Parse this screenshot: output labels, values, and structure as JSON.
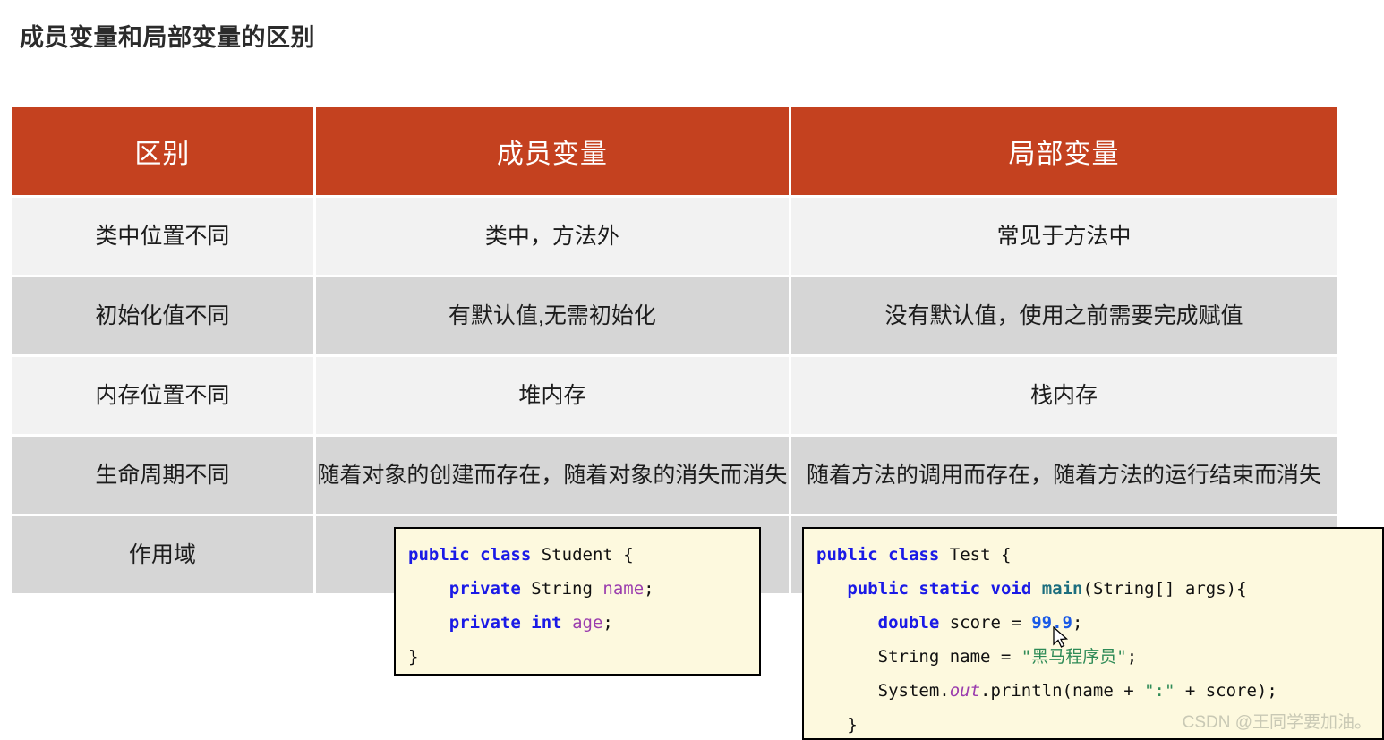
{
  "page": {
    "title": "成员变量和局部变量的区别",
    "watermark": "CSDN @王同学要加油。"
  },
  "table": {
    "headers": {
      "col1": "区别",
      "col2": "成员变量",
      "col3": "局部变量"
    },
    "rows": [
      {
        "diff": "类中位置不同",
        "member": "类中，方法外",
        "local": "常见于方法中"
      },
      {
        "diff": "初始化值不同",
        "member": "有默认值,无需初始化",
        "local": "没有默认值，使用之前需要完成赋值"
      },
      {
        "diff": "内存位置不同",
        "member": "堆内存",
        "local": "栈内存"
      },
      {
        "diff": "生命周期不同",
        "member": "随着对象的创建而存在，随着对象的消失而消失",
        "local": "随着方法的调用而存在，随着方法的运行结束而消失"
      },
      {
        "diff": "作用域",
        "member": "",
        "local": ""
      }
    ]
  },
  "code_student": {
    "line1_kw_public": "public",
    "line1_kw_class": "class",
    "line1_name": "Student",
    "line1_brace": "{",
    "line2_kw": "private",
    "line2_type": "String",
    "line2_field": "name",
    "line2_semi": ";",
    "line3_kw": "private",
    "line3_type": "int",
    "line3_field": "age",
    "line3_semi": ";",
    "line4_brace": "}"
  },
  "code_test": {
    "l1_public": "public",
    "l1_class": "class",
    "l1_name": "Test",
    "l1_brace": "{",
    "l2_public": "public",
    "l2_static": "static",
    "l2_void": "void",
    "l2_main": "main",
    "l2_args": "(String[] args){",
    "l3_double": "double",
    "l3_var": " score = ",
    "l3_num": "99.9",
    "l3_semi": ";",
    "l4_text": "String name = ",
    "l4_str": "\"黑马程序员\"",
    "l4_semi": ";",
    "l5_sys": "System.",
    "l5_out": "out",
    "l5_rest": ".println(name + ",
    "l5_str": "\":\"",
    "l5_tail": " + score);",
    "l6_brace": "}"
  },
  "colors": {
    "header_bg": "#C4411F",
    "row_light": "#F2F2F2",
    "row_dark": "#D6D6D6",
    "code_bg": "#FDF9DE",
    "keyword": "#1A1AE6",
    "field": "#9B3DAE",
    "string": "#2E8B57"
  }
}
